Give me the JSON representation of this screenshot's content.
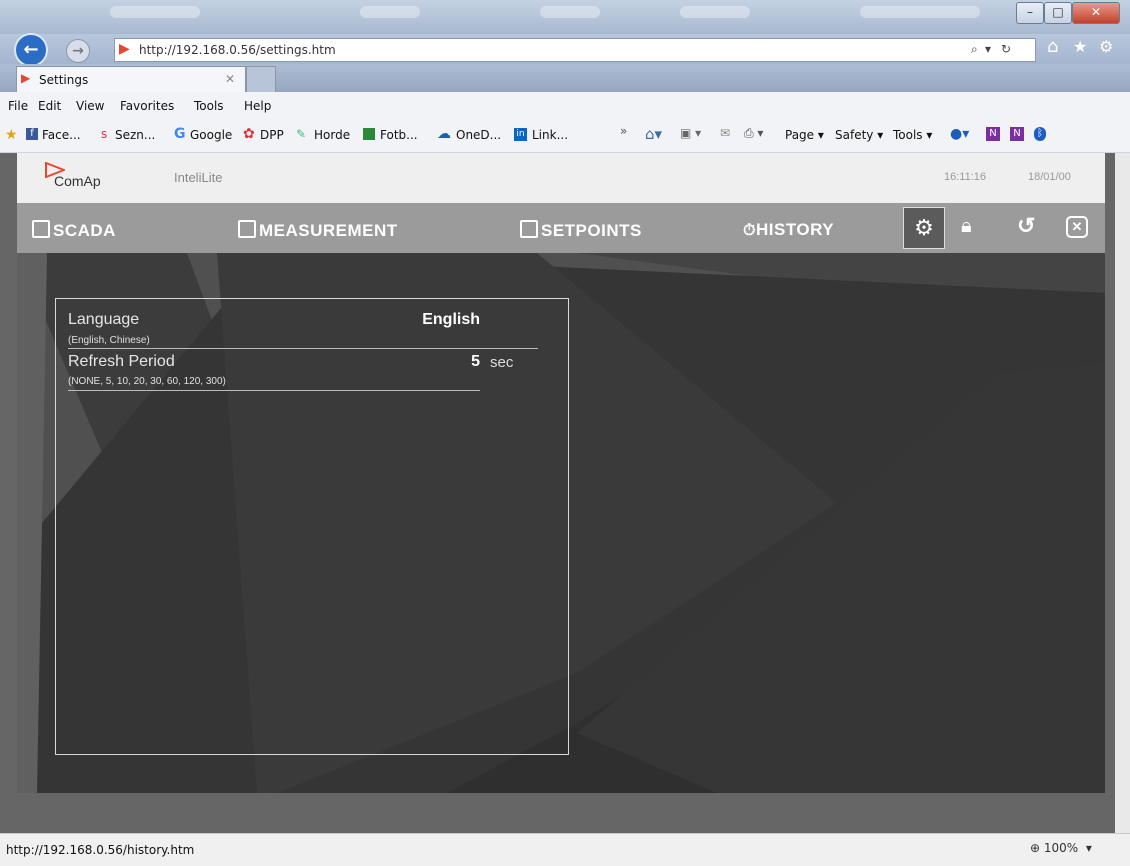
{
  "browser": {
    "url": "http://192.168.0.56/settings.htm",
    "tab_title": "Settings",
    "menu": [
      "File",
      "Edit",
      "View",
      "Favorites",
      "Tools",
      "Help"
    ],
    "favorites": [
      "Face...",
      "Sezn...",
      "Google",
      "DPP",
      "Horde",
      "Fotb...",
      "OneD...",
      "Link..."
    ],
    "commandbar": [
      "Page",
      "Safety",
      "Tools"
    ],
    "status_url": "http://192.168.0.56/history.htm",
    "zoom": "100%"
  },
  "app": {
    "logo": "ComAp",
    "product": "InteliLite",
    "time": "16:11:16",
    "date": "18/01/00",
    "nav": {
      "scada": "SCADA",
      "measurement": "MEASUREMENT",
      "setpoints": "SETPOINTS",
      "history": "HISTORY"
    }
  },
  "settings": [
    {
      "name": "Language",
      "options": "(English, Chinese)",
      "value": "English",
      "unit": ""
    },
    {
      "name": "Refresh Period",
      "options": "(NONE, 5, 10, 20, 30, 60, 120, 300)",
      "value": "5",
      "unit": "sec"
    }
  ],
  "colors": {
    "accent": "#e8472f",
    "nav_bg": "#9b9b9b",
    "page_bg": "#505050"
  }
}
